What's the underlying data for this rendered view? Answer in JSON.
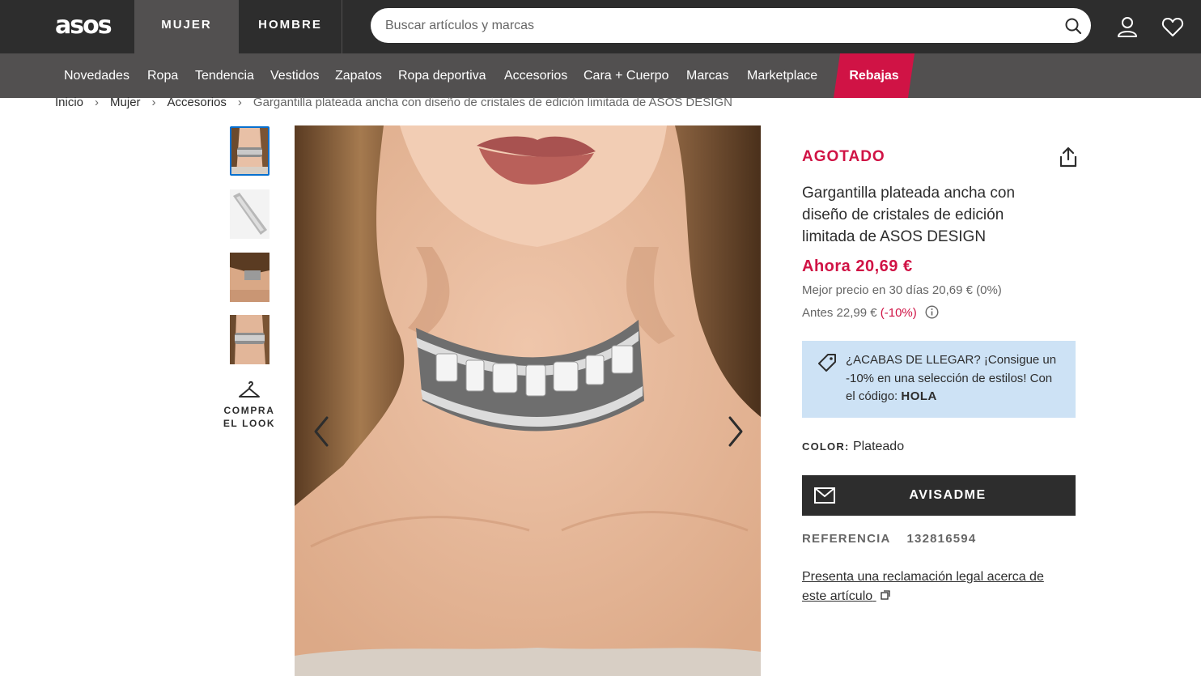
{
  "header": {
    "logo": "asos",
    "tabs": [
      "MUJER",
      "HOMBRE"
    ],
    "search_placeholder": "Buscar artículos y marcas",
    "icons": [
      "search-icon",
      "account-icon",
      "wishlist-heart-icon"
    ]
  },
  "nav": {
    "items": [
      "Novedades",
      "Ropa",
      "Tendencia",
      "Vestidos",
      "Zapatos",
      "Ropa deportiva",
      "Accesorios",
      "Cara + Cuerpo",
      "Marcas",
      "Marketplace"
    ],
    "sale": "Rebajas"
  },
  "breadcrumb": [
    "Inicio",
    "Mujer",
    "Accesorios",
    "Gargantilla plateada ancha con diseño de cristales de edición limitada de ASOS DESIGN"
  ],
  "breadcrumb_separator": "›",
  "gallery": {
    "shop_look_line1": "COMPRA",
    "shop_look_line2": "EL LOOK"
  },
  "product": {
    "status": "AGOTADO",
    "title": "Gargantilla plateada ancha con diseño de cristales de edición limitada de ASOS DESIGN",
    "price_now": "Ahora 20,69 €",
    "best_price": "Mejor precio en 30 días 20,69 € (0%)",
    "price_before": "Antes 22,99 €",
    "discount": "(-10%)",
    "promo_text": "¿ACABAS DE LLEGAR? ¡Consigue un -10% en una selección de estilos! Con el código: ",
    "promo_code": "HOLA",
    "color_label": "COLOR:",
    "color_value": "Plateado",
    "notify_button": "AVISADME",
    "reference_label": "REFERENCIA",
    "reference_value": "132816594",
    "legal_link": "Presenta una reclamación legal acerca de este artículo"
  },
  "colors": {
    "header_bg": "#2d2d2d",
    "nav_bg": "#525050",
    "sale_red": "#d01345",
    "promo_bg": "#cde2f5",
    "active_thumb_border": "#0770cf"
  }
}
